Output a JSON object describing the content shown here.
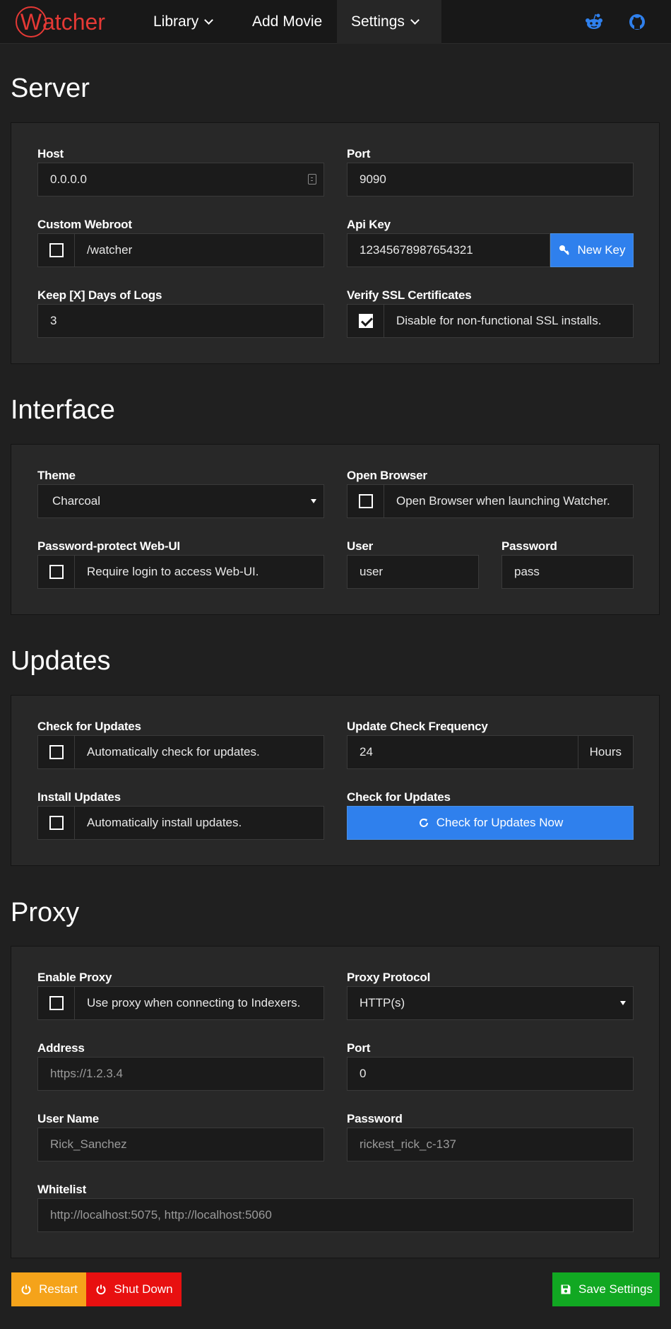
{
  "navbar": {
    "logo_letter": "W",
    "logo_rest": "atcher",
    "items": [
      {
        "label": "Library"
      },
      {
        "label": "Add Movie"
      },
      {
        "label": "Settings"
      }
    ],
    "icons": [
      "reddit-icon",
      "github-icon"
    ],
    "accent_color": "#e53935"
  },
  "server": {
    "title": "Server",
    "host_label": "Host",
    "host_value": "0.0.0.0",
    "port_label": "Port",
    "port_value": "9090",
    "webroot_label": "Custom Webroot",
    "webroot_value": "/watcher",
    "webroot_checked": false,
    "apikey_label": "Api Key",
    "apikey_value": "12345678987654321",
    "newkey_label": "New Key",
    "logs_label": "Keep [X] Days of Logs",
    "logs_value": "3",
    "ssl_label": "Verify SSL Certificates",
    "ssl_text": "Disable for non-functional SSL installs.",
    "ssl_checked": true
  },
  "interface": {
    "title": "Interface",
    "theme_label": "Theme",
    "theme_value": "Charcoal",
    "browser_label": "Open Browser",
    "browser_text": "Open Browser when launching Watcher.",
    "pwprotect_label": "Password-protect Web-UI",
    "pwprotect_text": "Require login to access Web-UI.",
    "user_label": "User",
    "user_value": "user",
    "password_label": "Password",
    "password_value": "pass"
  },
  "updates": {
    "title": "Updates",
    "check_label": "Check for Updates",
    "check_text": "Automatically check for updates.",
    "freq_label": "Update Check Frequency",
    "freq_value": "24",
    "freq_unit": "Hours",
    "install_label": "Install Updates",
    "install_text": "Automatically install updates.",
    "checknow_label": "Check for Updates",
    "checknow_button": "Check for Updates Now"
  },
  "proxy": {
    "title": "Proxy",
    "enable_label": "Enable Proxy",
    "enable_text": "Use proxy when connecting to Indexers.",
    "protocol_label": "Proxy Protocol",
    "protocol_value": "HTTP(s)",
    "address_label": "Address",
    "address_placeholder": "https://1.2.3.4",
    "port_label": "Port",
    "port_value": "0",
    "username_label": "User Name",
    "username_placeholder": "Rick_Sanchez",
    "password_label": "Password",
    "password_placeholder": "rickest_rick_c-137",
    "whitelist_label": "Whitelist",
    "whitelist_placeholder": "http://localhost:5075, http://localhost:5060"
  },
  "footer": {
    "restart_label": "Restart",
    "shutdown_label": "Shut Down",
    "save_label": "Save Settings"
  },
  "colors": {
    "background": "#202020",
    "panel": "#282828",
    "blue": "#2f80ed",
    "orange": "#f5a31a",
    "red": "#e81010",
    "green": "#11a822"
  }
}
